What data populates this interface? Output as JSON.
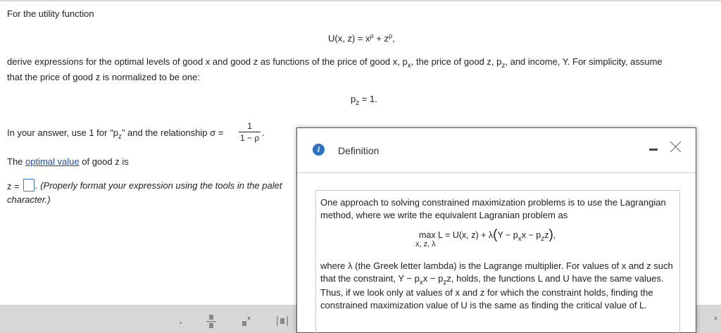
{
  "problem": {
    "intro": "For the utility function",
    "utility_lhs": "U(x, z) = x",
    "utility_exp1": "ρ",
    "utility_mid": " + z",
    "utility_exp2": "ρ",
    "utility_end": ",",
    "derive_line1_a": "derive expressions for the optimal levels of good x and good z as functions of the price of good x, p",
    "derive_line1_sub1": "x",
    "derive_line1_b": ", the price of good z, p",
    "derive_line1_sub2": "z",
    "derive_line1_c": ", and income, Y.  For simplicity, assume",
    "derive_line2": "that the price of good z is normalized to be one:",
    "pz_p": "p",
    "pz_sub": "z",
    "pz_val": " = 1.",
    "answer_note_a": "In your answer, use 1 for \"p",
    "answer_note_sub": "z",
    "answer_note_b": "\" and the relationship σ =",
    "frac_num": "1",
    "frac_den": "1 − ρ",
    "frac_end": ".",
    "optimal_pre": "The ",
    "optimal_link": "optimal value",
    "optimal_post": " of good z is",
    "z_label": "z =",
    "hint_line1": ". (Properly format your expression using the tools in the palet",
    "hint_line2": "character.)"
  },
  "palette": {
    "icons": [
      "dot-icon",
      "fraction-icon",
      "superscript-icon",
      "absolute-value-icon"
    ],
    "glyphs": [
      "•",
      "▪",
      "▪'",
      "|▪|"
    ]
  },
  "right_strip_glyph": "›",
  "popup": {
    "title": "Definition",
    "para1": "One approach to solving constrained maximization problems is to use the Lagrangian method, where we write the equivalent Lagranian problem as",
    "eq_max": "max L = U(x, z) + λ",
    "eq_inner_a": "Y − p",
    "eq_inner_sub1": "x",
    "eq_inner_b": "x − p",
    "eq_inner_sub2": "z",
    "eq_inner_c": "z",
    "eq_end": ",",
    "eq_under": "x, z, λ",
    "para2_a": "where λ (the Greek letter lambda) is the Lagrange multiplier.  For values of x and z such that the constraint, Y − p",
    "para2_sub1": "x",
    "para2_b": "x − p",
    "para2_sub2": "z",
    "para2_c": "z, holds, the functions L and U have the same values.  Thus, if we look only at values of x and z for which the constraint holds, finding the constrained maximization value of U is the same as finding the critical value of L."
  }
}
